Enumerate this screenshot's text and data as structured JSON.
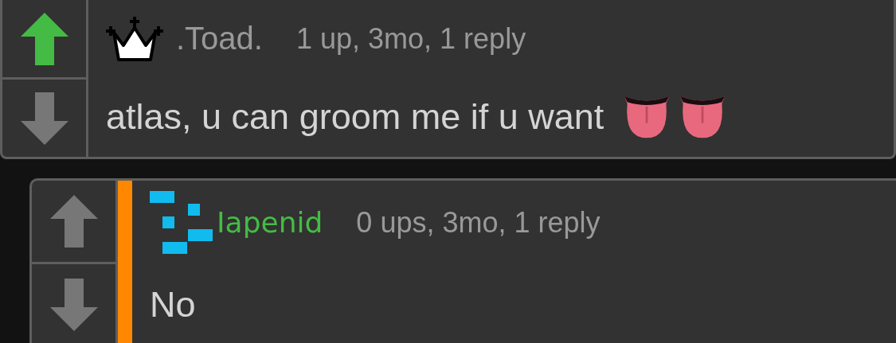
{
  "comments": [
    {
      "author": {
        "name": ".Toad.",
        "badge": {
          "kind": "crown"
        },
        "color": "#999999"
      },
      "meta": "1 up, 3mo, 1 reply",
      "text": "atlas, u can groom me if u want",
      "emoji": [
        {
          "kind": "tongue"
        },
        {
          "kind": "tongue"
        }
      ],
      "upvoted": true,
      "downvoted": false,
      "children": [
        {
          "author": {
            "name": "Iapenid",
            "badge": {
              "kind": "blocks"
            },
            "color": "#44bb44"
          },
          "meta": "0 ups, 3mo, 1 reply",
          "text": "No",
          "upvoted": false,
          "downvoted": false
        }
      ]
    }
  ]
}
